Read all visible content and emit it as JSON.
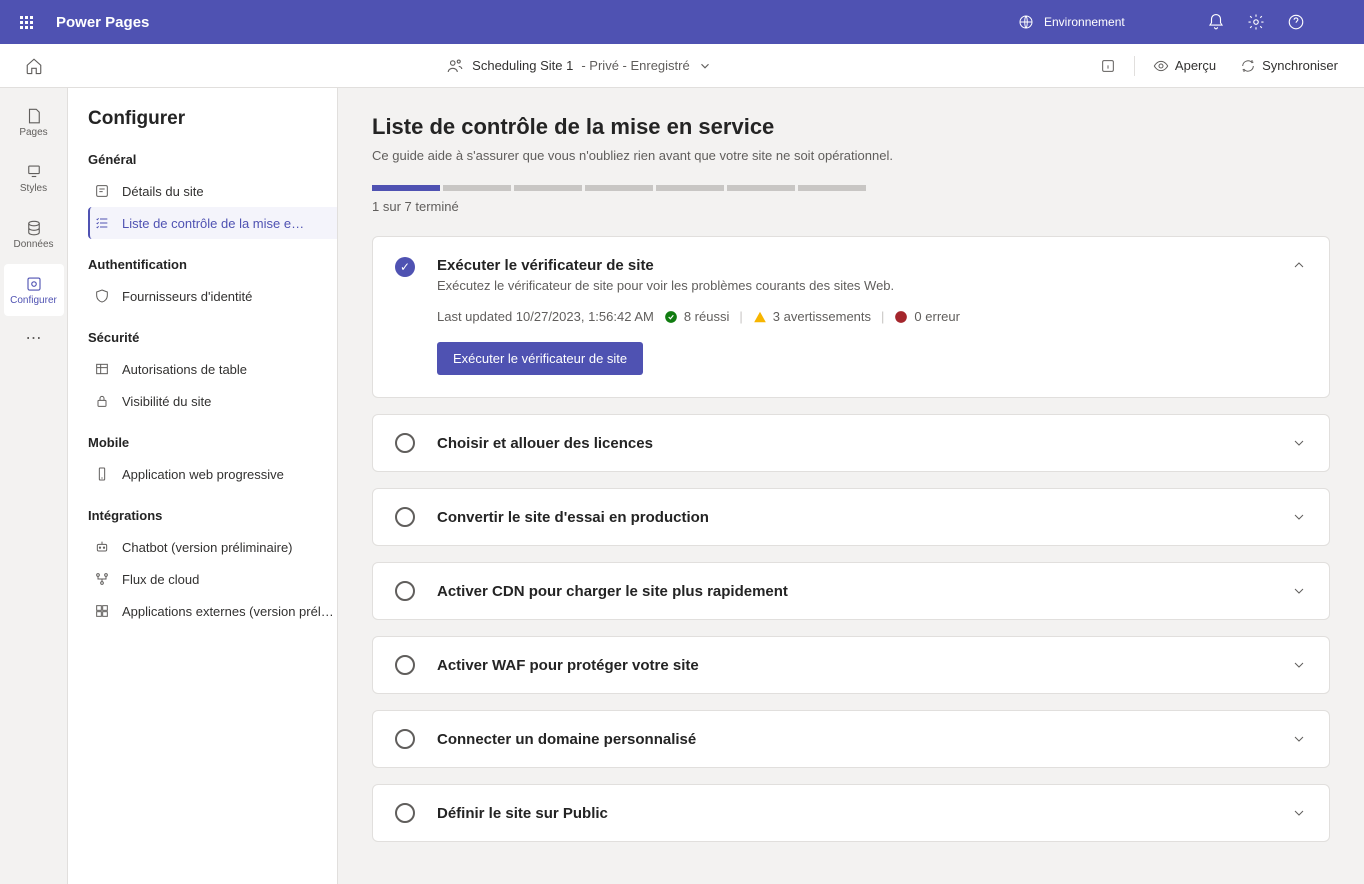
{
  "header": {
    "app_title": "Power Pages",
    "env_label": "Environnement",
    "env_name": " "
  },
  "subheader": {
    "site_name": "Scheduling Site 1",
    "site_status": " - Privé - Enregistré",
    "preview": "Aperçu",
    "sync": "Synchroniser"
  },
  "rail": {
    "pages": "Pages",
    "styles": "Styles",
    "data": "Données",
    "configure": "Configurer"
  },
  "sidebar": {
    "title": "Configurer",
    "groups": {
      "general": {
        "label": "Général",
        "items": [
          "Détails du site",
          "Liste de contrôle de la mise e…"
        ]
      },
      "auth": {
        "label": "Authentification",
        "items": [
          "Fournisseurs d'identité"
        ]
      },
      "security": {
        "label": "Sécurité",
        "items": [
          "Autorisations de table",
          "Visibilité du site"
        ]
      },
      "mobile": {
        "label": "Mobile",
        "items": [
          "Application web progressive"
        ]
      },
      "integrations": {
        "label": "Intégrations",
        "items": [
          "Chatbot (version préliminaire)",
          "Flux de cloud",
          "Applications externes (version prél…"
        ]
      }
    }
  },
  "main": {
    "title": "Liste de contrôle de la mise en service",
    "desc": "Ce guide aide à s'assurer que vous n'oubliez rien avant que votre site ne soit opérationnel.",
    "progress_text": "1 sur 7 terminé",
    "segments": 7,
    "done": 1,
    "card0": {
      "title": "Exécuter le vérificateur de site",
      "subtitle": "Exécutez le vérificateur de site pour voir les problèmes courants des sites Web.",
      "updated": "Last updated 10/27/2023, 1:56:42 AM",
      "success_count": "8 réussi",
      "warning_count": "3 avertissements",
      "error_count": "0 erreur",
      "button": "Exécuter le vérificateur de site"
    },
    "card1": "Choisir et allouer des licences",
    "card2": "Convertir le site d'essai en production",
    "card3": "Activer CDN pour charger le site plus rapidement",
    "card4": "Activer WAF pour protéger votre site",
    "card5": "Connecter un domaine personnalisé",
    "card6": "Définir le site sur Public"
  }
}
